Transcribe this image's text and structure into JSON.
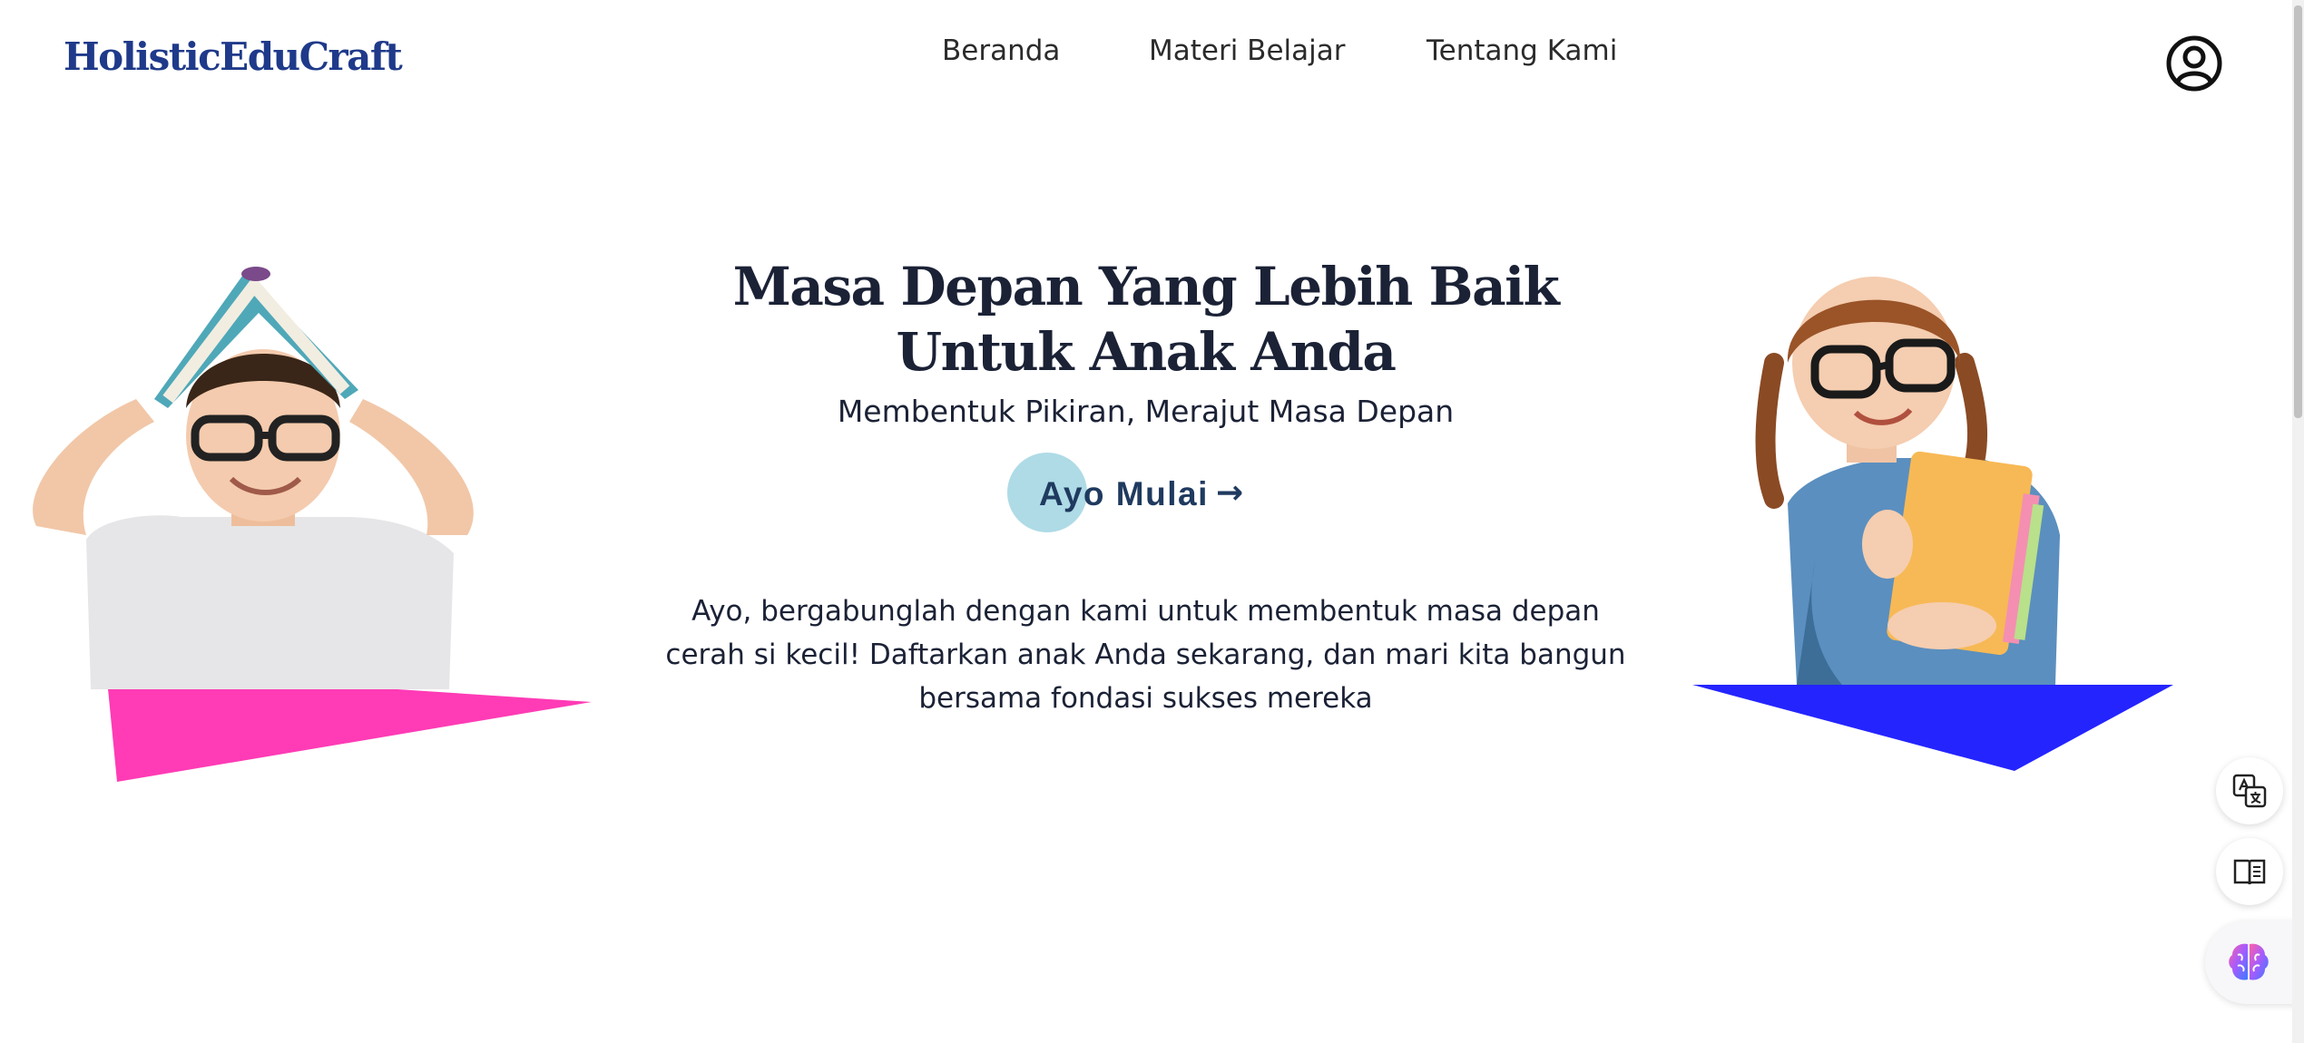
{
  "header": {
    "logo": "HolisticEduCraft",
    "nav": [
      {
        "label": "Beranda"
      },
      {
        "label": "Materi Belajar"
      },
      {
        "label": "Tentang Kami"
      }
    ],
    "user_icon": "user-circle-icon"
  },
  "hero": {
    "title": "Masa Depan Yang Lebih Baik Untuk Anak Anda",
    "subtitle": "Membentuk Pikiran, Merajut Masa Depan",
    "cta_label": "Ayo Mulai",
    "cta_arrow": "→",
    "description": "Ayo, bergabunglah dengan kami untuk membentuk masa depan cerah si kecil! Daftarkan anak Anda sekarang, dan mari kita bangun bersama fondasi sukses mereka"
  },
  "colors": {
    "brand": "#1f3a8a",
    "text": "#1b2236",
    "cta_circle": "#aedbe6",
    "pink_shape": "#ff3bb5",
    "blue_shape": "#2424ff"
  },
  "widgets": {
    "translate_icon": "translate-icon",
    "reader_icon": "book-reader-icon",
    "assistant_icon": "brain-icon"
  }
}
